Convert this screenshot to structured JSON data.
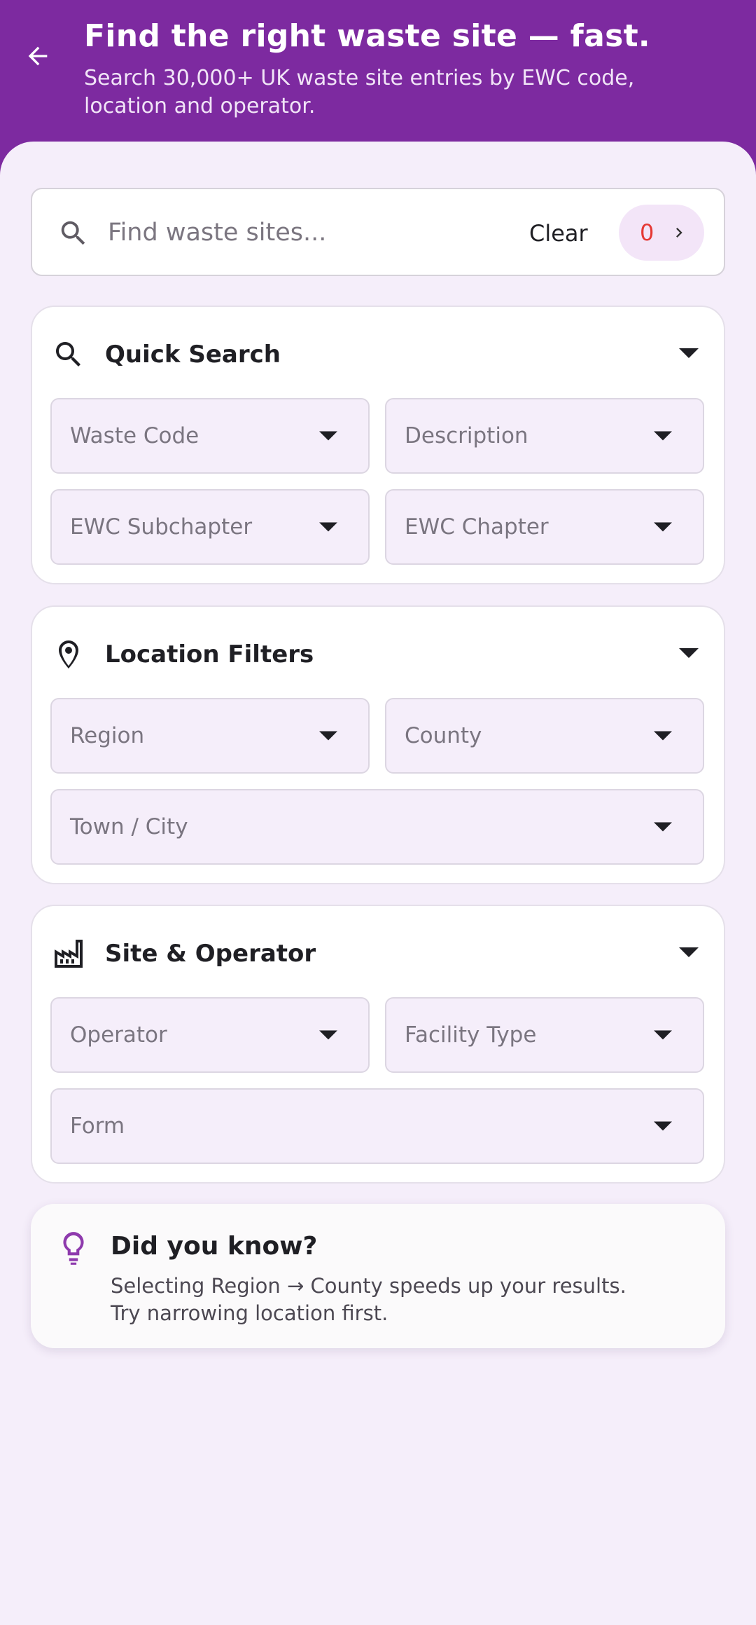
{
  "header": {
    "title": "Find the right waste site — fast.",
    "subtitle": "Search 30,000+ UK waste site entries by EWC code, location and operator."
  },
  "search": {
    "placeholder": "Find waste sites...",
    "clear_label": "Clear",
    "result_count": "0"
  },
  "sections": {
    "quick_search": {
      "title": "Quick Search",
      "fields": {
        "waste_code": "Waste Code",
        "description": "Description",
        "ewc_subchapter": "EWC Subchapter",
        "ewc_chapter": "EWC Chapter"
      }
    },
    "location": {
      "title": "Location Filters",
      "fields": {
        "region": "Region",
        "county": "County",
        "town_city": "Town / City"
      }
    },
    "site_operator": {
      "title": "Site & Operator",
      "fields": {
        "operator": "Operator",
        "facility_type": "Facility Type",
        "form": "Form"
      }
    }
  },
  "tip": {
    "title": "Did you know?",
    "text": "Selecting Region → County speeds up your results.\nTry narrowing location first."
  },
  "colors": {
    "header_bg": "#7d2aa0",
    "page_bg": "#f5eefa",
    "count_color": "#e53935",
    "accent": "#8e3aad"
  },
  "icons": {
    "back": "arrow-left-icon",
    "search": "search-icon",
    "location": "location-pin-icon",
    "site": "factory-icon",
    "tip": "lightbulb-icon"
  }
}
